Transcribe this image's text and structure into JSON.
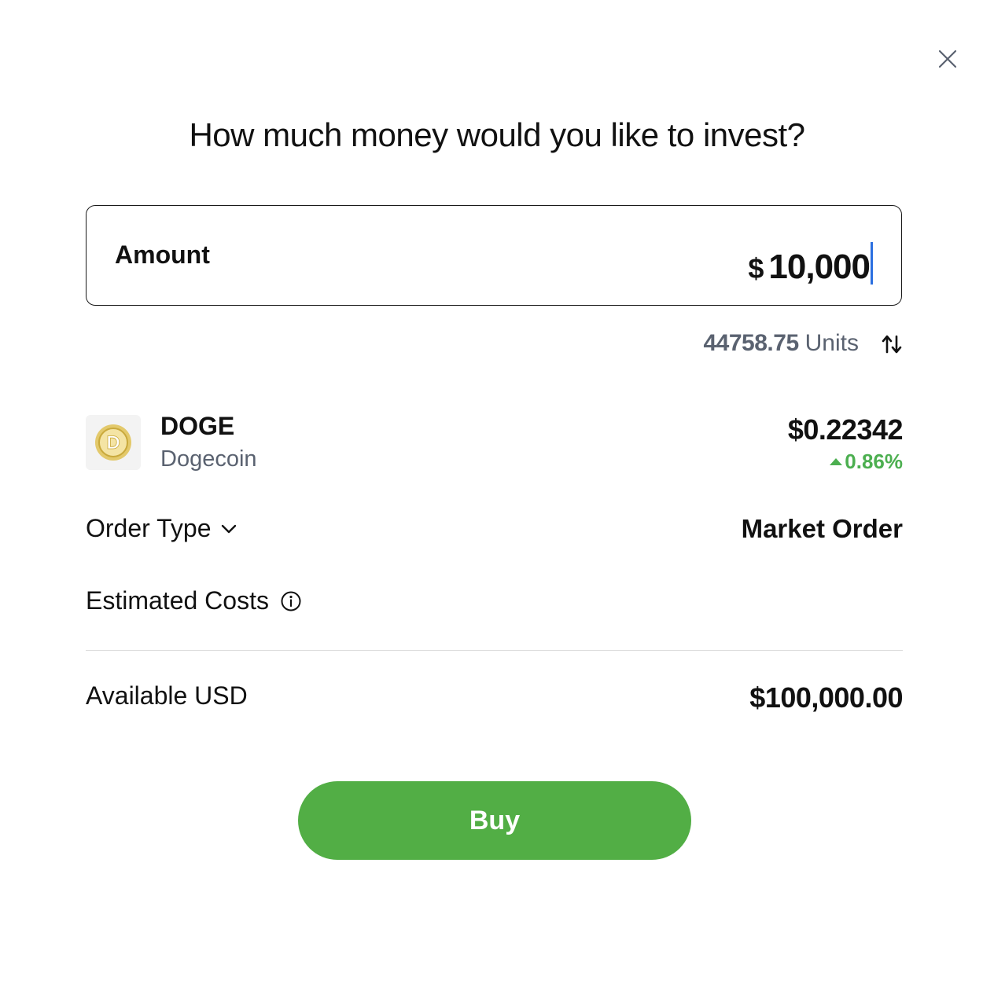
{
  "dialog": {
    "title": "How much money would you like to invest?",
    "close_icon": "close-icon"
  },
  "amount": {
    "label": "Amount",
    "currency": "$",
    "value": "10,000"
  },
  "units": {
    "value": "44758.75",
    "label": "Units",
    "swap_icon": "swap-arrows-icon"
  },
  "asset": {
    "symbol": "DOGE",
    "name": "Dogecoin",
    "price": "$0.22342",
    "change": "0.86%",
    "change_direction": "up",
    "logo_icon": "dogecoin-logo-icon"
  },
  "order": {
    "label": "Order Type",
    "value": "Market Order"
  },
  "estimated_costs": {
    "label": "Estimated Costs",
    "info_icon": "info-icon"
  },
  "available": {
    "label": "Available USD",
    "value": "$100,000.00"
  },
  "actions": {
    "buy_label": "Buy"
  },
  "colors": {
    "accent_green": "#52ae45",
    "positive_change": "#4caf50",
    "caret_blue": "#2b6fe0",
    "muted_text": "#5a6270"
  }
}
